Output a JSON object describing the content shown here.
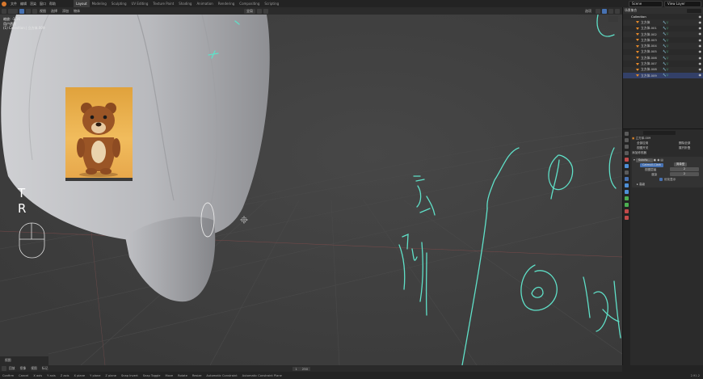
{
  "topbar": {
    "menus": [
      "文件",
      "编辑",
      "渲染",
      "窗口",
      "帮助"
    ],
    "workspaces": [
      "Layout",
      "Modeling",
      "Sculpting",
      "UV Editing",
      "Texture Paint",
      "Shading",
      "Animation",
      "Rendering",
      "Compositing",
      "Scripting"
    ],
    "active_workspace": "Layout",
    "scene": "Scene",
    "view_layer": "View Layer"
  },
  "viewport_header": {
    "items": [
      "视图",
      "选择",
      "添加",
      "物体"
    ],
    "transform_orientation": "全局",
    "shading_label": "选项"
  },
  "viewport": {
    "info_line1": "缩放: -1.16",
    "info_line2": "用户透视",
    "info_line3": "(1) Collection | 立方体.009",
    "overlay_text_t": "T",
    "overlay_text_r": "R"
  },
  "annotations_color": "#5fe0c8",
  "outliner": {
    "header": "场景集合",
    "collection": "Collection",
    "objects": [
      "立方体",
      "立方体.001",
      "立方体.002",
      "立方体.003",
      "立方体.004",
      "立方体.005",
      "立方体.006",
      "立方体.007",
      "立方体.008",
      "立方体.009"
    ],
    "selected": "立方体.009"
  },
  "properties": {
    "object_name": "立方体.009",
    "add_modifier": "添加修改器",
    "modifier_name": "Subdiv...",
    "catmull_clark": "Catmull-Clark",
    "simple": "简单型",
    "levels_viewport_label": "视图层级",
    "levels_viewport": "2",
    "levels_render_label": "渲染",
    "levels_render": "2",
    "optimal_display": "优化显示",
    "advanced": "高级",
    "row_a": [
      "全部应用",
      "删除全部"
    ],
    "row_b": [
      "视图开关",
      "展开折叠"
    ]
  },
  "bottom_header": {
    "items": [
      "回放",
      "抠像",
      "视图",
      "标记"
    ],
    "frame_start": "1",
    "frame_end": "250"
  },
  "status": {
    "items": [
      "Confirm",
      "Cancel",
      "X axis",
      "Y axis",
      "Z axis",
      "X plane",
      "Y plane",
      "Z plane",
      "Snap Invert",
      "Snap Toggle",
      "Move",
      "Rotate",
      "Resize",
      "Automatic Constraint",
      "Automatic Constraint Plane"
    ],
    "version": "2.91.2"
  },
  "timeline_label": "视图"
}
